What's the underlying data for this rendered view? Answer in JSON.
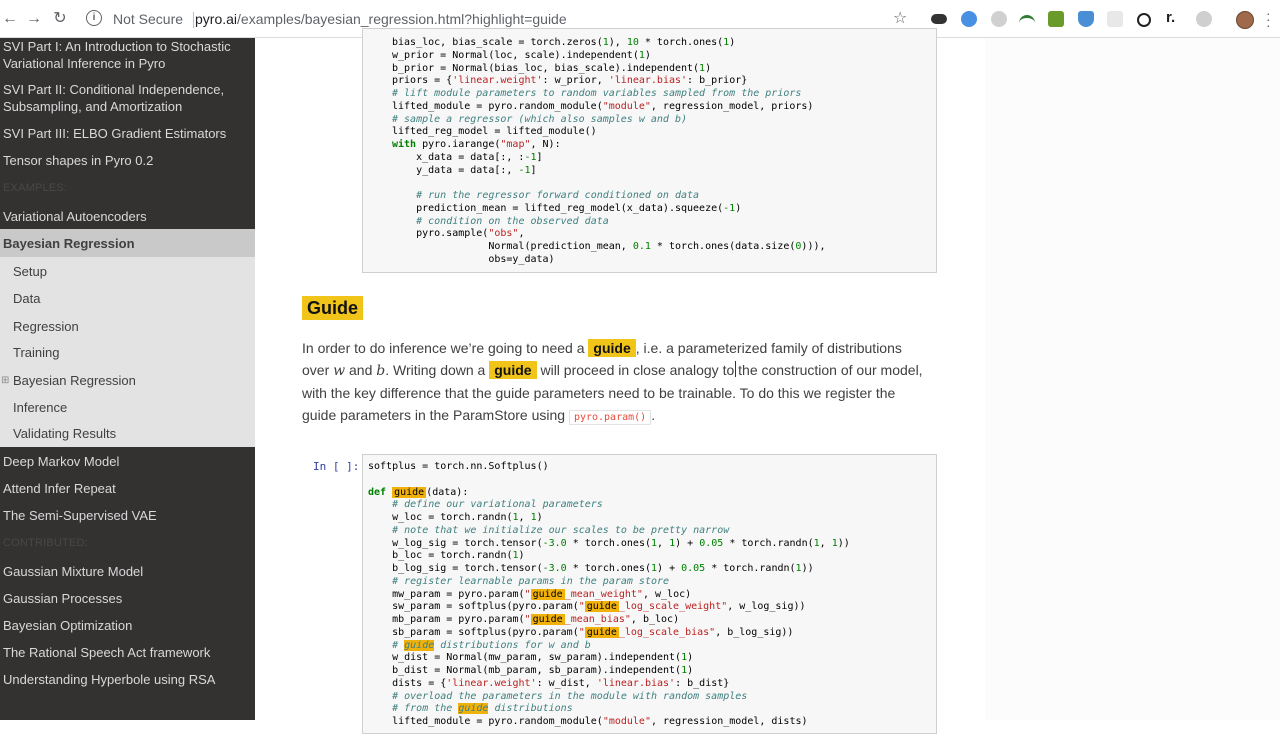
{
  "browser": {
    "security_label": "Not Secure",
    "url_host": "pyro.ai",
    "url_path": "/examples/bayesian_regression.html?highlight=guide",
    "back_icon": "arrow-left-icon",
    "forward_icon": "arrow-right-icon",
    "reload_icon": "reload-icon",
    "star_icon": "star-icon"
  },
  "sidebar": {
    "top_items": [
      "SVI Part I: An Introduction to Stochastic Variational Inference in Pyro",
      "SVI Part II: Conditional Independence, Subsampling, and Amortization",
      "SVI Part III: ELBO Gradient Estimators",
      "Tensor shapes in Pyro 0.2"
    ],
    "examples_caption": "EXAMPLES:",
    "vae": "Variational Autoencoders",
    "current": "Bayesian Regression",
    "sub_items": [
      "Setup",
      "Data",
      "Regression",
      "Training",
      "Bayesian Regression",
      "Inference",
      "Validating Results"
    ],
    "after_items": [
      "Deep Markov Model",
      "Attend Infer Repeat",
      "The Semi-Supervised VAE"
    ],
    "contributed_caption": "CONTRIBUTED:",
    "contributed_items": [
      "Gaussian Mixture Model",
      "Gaussian Processes",
      "Bayesian Optimization",
      "The Rational Speech Act framework",
      "Understanding Hyperbole using RSA"
    ]
  },
  "main": {
    "heading": "Guide",
    "para_1": "In order to do inference we’re going to need a",
    "hl_1": "guide",
    "para_2": ", i.e. a parameterized family of distributions over",
    "var_w": "w",
    "para_and": "and",
    "var_b": "b",
    "para_3": ". Writing down a",
    "hl_2": "guide",
    "para_4": "will proceed in close analogy to the construction of our model, with the key difference that the guide parameters need to be trainable. To do this we register the guide parameters in the ParamStore using",
    "code_inline": "pyro.param()",
    "para_end": ".",
    "prompt": "In [ ]:"
  },
  "colors": {
    "sidebar_bg": "#343131",
    "highlight": "#f0c419",
    "comment": "#408080",
    "keyword": "#008000"
  }
}
